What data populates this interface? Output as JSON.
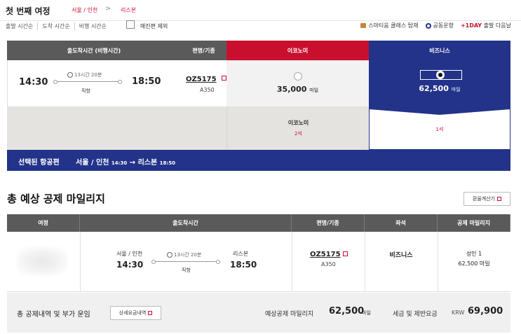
{
  "header": {
    "title": "첫 번째 여정",
    "route_origin": "서울 / 인천",
    "route_sep": ">",
    "route_dest": "리스본"
  },
  "sort": {
    "options": [
      "출발 시간순",
      "도착 시간순",
      "비행 시간순"
    ],
    "exclude_soldout": "매진편 제외"
  },
  "legend": {
    "smartium": "스마티움 클래스 탑재",
    "codeshare": "공동운항",
    "oneday_tag": "+1DAY",
    "oneday_text": "출발 다음날",
    "smartium_color": "#c9843b",
    "codeshare_color": "#23338a"
  },
  "flight_table": {
    "headers": {
      "time": "출도착시간 (비행시간)",
      "flight": "편명/기종",
      "economy": "이코노미",
      "business": "비즈니스"
    },
    "flight": {
      "dep": "14:30",
      "arr": "18:50",
      "duration": "13시간 20분",
      "type": "직항",
      "flight_no": "OZ5175",
      "aircraft": "A350"
    },
    "economy": {
      "miles": "35,000",
      "unit": "마일",
      "label": "이코노미",
      "seats": "2석"
    },
    "business": {
      "miles": "62,500",
      "unit": "마일",
      "seats": "1석"
    },
    "selected": {
      "label": "선택된 항공편",
      "origin": "서울 / 인천",
      "dep": "14:30",
      "arrow": "→",
      "dest": "리스본",
      "arr": "18:50"
    }
  },
  "summary": {
    "title": "총 예상 공제 마일리지",
    "calc_button": "환율계산기",
    "headers": [
      "여정",
      "출도착시간",
      "편명/기종",
      "좌석",
      "공제 마일리지"
    ],
    "row": {
      "origin": "서울 / 인천",
      "dep": "14:30",
      "dest": "리스본",
      "arr": "18:50",
      "duration": "13시간 20분",
      "type": "직항",
      "flight_no": "OZ5175",
      "aircraft": "A350",
      "cabin": "비즈니스",
      "pax": "성인 1",
      "miles": "62,500 마일"
    }
  },
  "totals": {
    "label": "총 공제내역 및 부가 운임",
    "detail_button": "상세요금내역",
    "miles_label": "예상공제 마일리지",
    "miles": "62,500",
    "miles_unit": "마일",
    "tax_label": "세금 및 제반요금",
    "currency": "KRW",
    "tax": "69,900"
  },
  "colors": {
    "accent_red": "#c8102e",
    "navy": "#23338a",
    "header_gray": "#5a5a5a"
  }
}
